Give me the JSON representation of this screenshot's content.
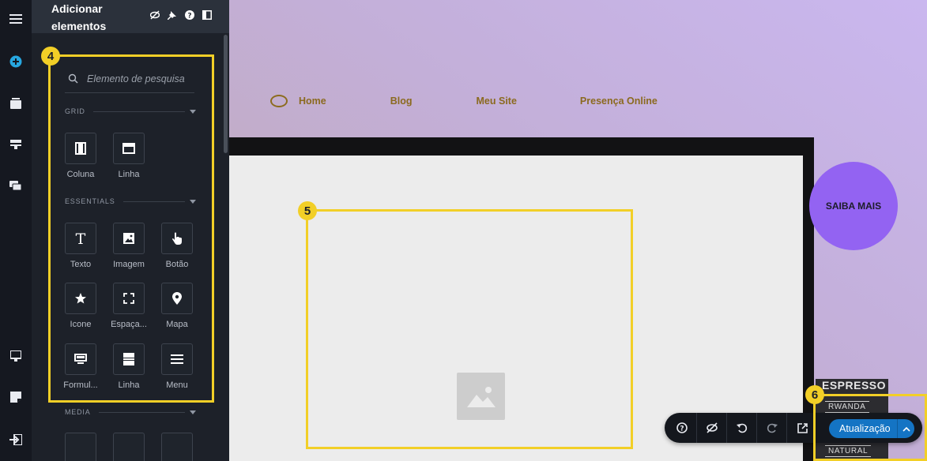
{
  "panel": {
    "title": "Adicionar elementos",
    "search_placeholder": "Elemento de pesquisa",
    "sections": {
      "grid": "GRID",
      "essentials": "ESSENTIALS",
      "media": "MEDIA"
    },
    "grid_items": [
      "Coluna",
      "Linha"
    ],
    "essentials_items": [
      "Texto",
      "Imagem",
      "Botão",
      "Icone",
      "Espaça...",
      "Mapa",
      "Formul...",
      "Linha",
      "Menu"
    ]
  },
  "badges": {
    "panel": "4",
    "image": "5",
    "toolbar": "6"
  },
  "site": {
    "nav": [
      "Home",
      "Blog",
      "Meu Site",
      "Presença Online"
    ],
    "cta": "SAIBA MAIS",
    "chalk_title": "ESPRESSO",
    "chalk_line1": "RWANDA",
    "chalk_line2": "NATURAL"
  },
  "toolbar": {
    "update_label": "Atualização"
  },
  "colors": {
    "highlight": "#f2cf27",
    "accent": "#1474c4",
    "cta": "#9363f2",
    "nav_text": "#8b6a1f"
  },
  "icons": {
    "rail": [
      "hamburger-icon",
      "plus-circle-icon",
      "pages-icon",
      "sections-icon",
      "chat-icon",
      "desktop-icon",
      "notes-icon",
      "exit-icon"
    ],
    "header": [
      "eye-off-icon",
      "pin-icon",
      "help-icon",
      "sidebar-toggle-icon"
    ],
    "toolbar": [
      "help-icon",
      "eye-off-icon",
      "undo-icon",
      "redo-icon",
      "open-external-icon",
      "chevron-up-icon"
    ]
  }
}
